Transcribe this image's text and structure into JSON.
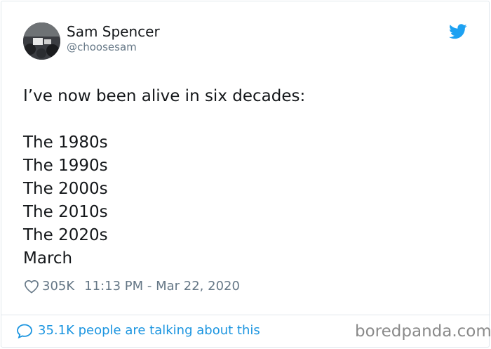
{
  "author": {
    "name": "Sam Spencer",
    "handle": "@choosesam",
    "avatar_icon": "avatar-photo"
  },
  "tweet": {
    "text": "I’ve now been alive in six decades:\n\nThe 1980s\nThe 1990s\nThe 2000s\nThe 2010s\nThe 2020s\nMarch",
    "likes": "305K",
    "timestamp": "11:13 PM - Mar 22, 2020"
  },
  "footer": {
    "conversation": "35.1K people are talking about this"
  },
  "watermark": "boredpanda.com",
  "colors": {
    "twitter_blue": "#1da1f2",
    "link_blue": "#1b95e0",
    "secondary_text": "#657786"
  }
}
